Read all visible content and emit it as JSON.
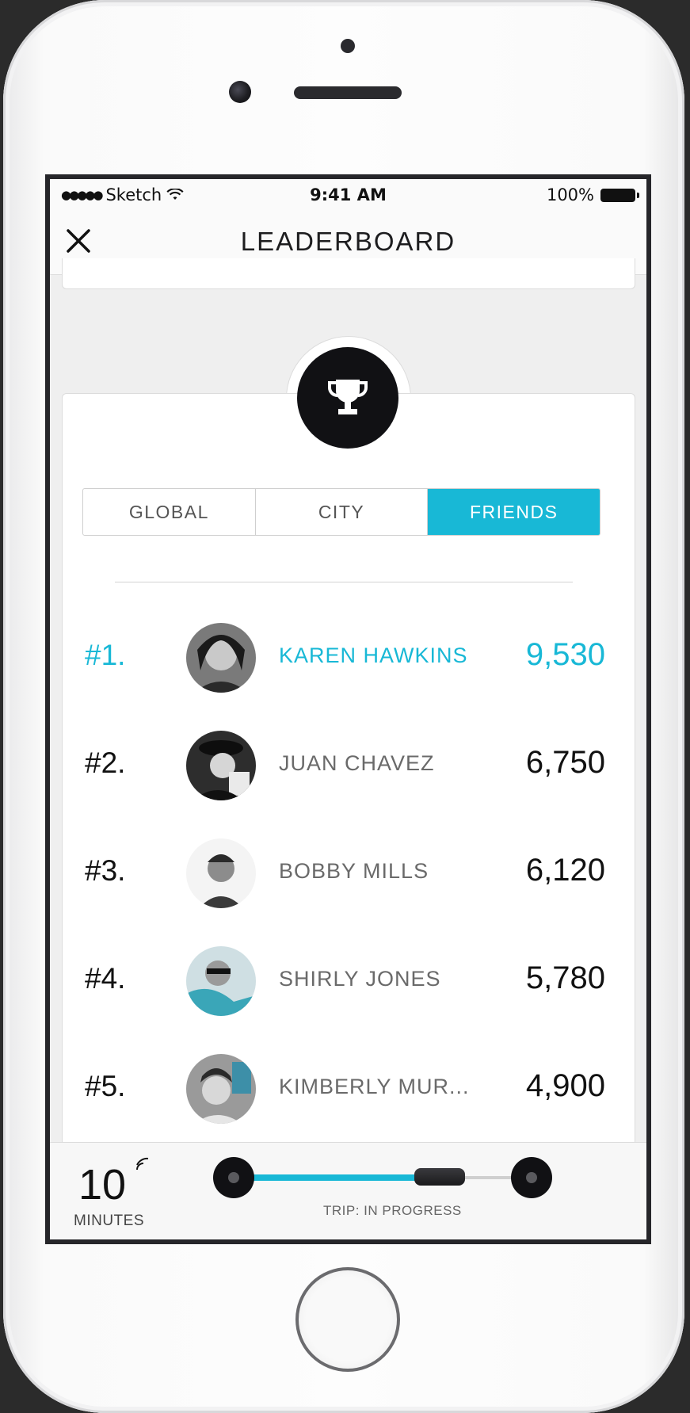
{
  "status_bar": {
    "carrier": "Sketch",
    "time": "9:41 AM",
    "battery": "100%"
  },
  "header": {
    "title": "LEADERBOARD"
  },
  "tabs": [
    {
      "label": "GLOBAL",
      "active": false
    },
    {
      "label": "CITY",
      "active": false
    },
    {
      "label": "FRIENDS",
      "active": true
    }
  ],
  "leaderboard": [
    {
      "rank": "#1.",
      "name": "KAREN HAWKINS",
      "score": "9,530"
    },
    {
      "rank": "#2.",
      "name": "JUAN CHAVEZ",
      "score": "6,750"
    },
    {
      "rank": "#3.",
      "name": "BOBBY MILLS",
      "score": "6,120"
    },
    {
      "rank": "#4.",
      "name": "SHIRLY JONES",
      "score": "5,780"
    },
    {
      "rank": "#5.",
      "name": "KIMBERLY MUR...",
      "score": "4,900"
    }
  ],
  "trip": {
    "minutes": "10",
    "minutes_label": "MINUTES",
    "status": "TRIP: IN PROGRESS",
    "progress": 0.75
  },
  "colors": {
    "accent": "#18b8d6",
    "dark": "#111114"
  },
  "icons": [
    "close-icon",
    "trophy-icon",
    "wifi-icon",
    "battery-icon",
    "signal-icon",
    "car-icon"
  ]
}
